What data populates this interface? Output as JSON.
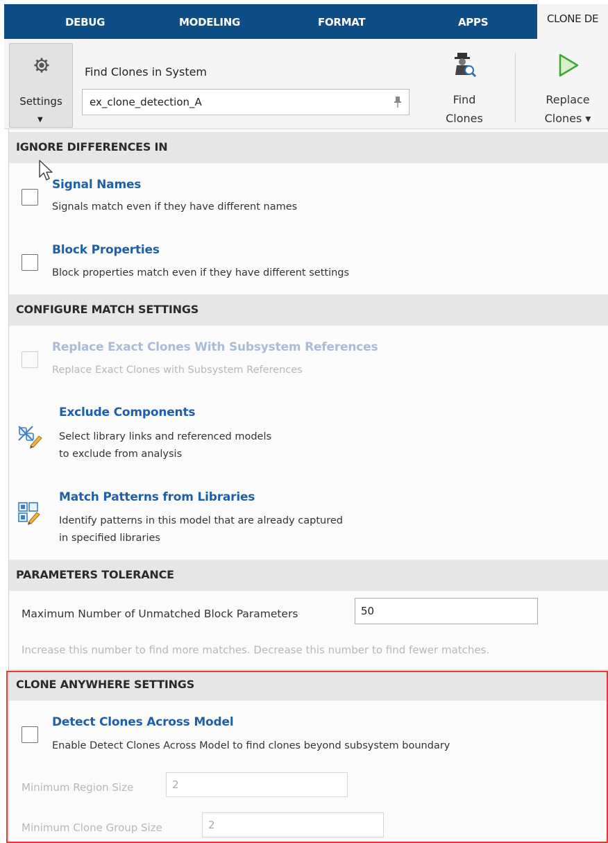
{
  "ribbon": {
    "tabs": [
      "DEBUG",
      "MODELING",
      "FORMAT",
      "APPS"
    ],
    "active_tab": "CLONE DE"
  },
  "toolstrip": {
    "settings_label": "Settings",
    "find_in_system_label": "Find Clones in System",
    "system_value": "ex_clone_detection_A",
    "find_clones_label": [
      "Find",
      "Clones"
    ],
    "replace_clones_label": [
      "Replace",
      "Clones ▾"
    ]
  },
  "ignore": {
    "header": "IGNORE DIFFERENCES IN",
    "signal_names": {
      "title": "Signal Names",
      "desc": "Signals match even if they have different names",
      "checked": false
    },
    "block_properties": {
      "title": "Block Properties",
      "desc": "Block properties match even if they have different settings",
      "checked": false
    }
  },
  "match": {
    "header": "CONFIGURE MATCH SETTINGS",
    "replace_exact": {
      "title": "Replace Exact Clones With Subsystem References",
      "desc": "Replace Exact Clones with Subsystem References",
      "enabled": false
    },
    "exclude": {
      "title": "Exclude Components",
      "desc_line1": "Select library links and referenced models",
      "desc_line2": "to exclude from analysis",
      "icon": "exclude-components-icon"
    },
    "patterns": {
      "title": "Match Patterns from Libraries",
      "desc_line1": "Identify patterns in this model that are already captured",
      "desc_line2": "in specified libraries",
      "icon": "library-patterns-icon"
    }
  },
  "tolerance": {
    "header": "PARAMETERS TOLERANCE",
    "max_label": "Maximum Number of Unmatched Block Parameters",
    "max_value": "50",
    "hint": "Increase this number to find more matches.  Decrease this number to find fewer matches."
  },
  "anywhere": {
    "header": "CLONE ANYWHERE SETTINGS",
    "detect": {
      "title": "Detect Clones Across Model",
      "desc": "Enable Detect Clones Across Model to find clones beyond subsystem boundary",
      "checked": false
    },
    "min_region_label": "Minimum Region Size",
    "min_region_value": "2",
    "min_group_label": "Minimum Clone Group Size",
    "min_group_value": "2"
  },
  "colors": {
    "ribbon": "#0f4d86",
    "link": "#1f5fa8",
    "highlight": "#e53935"
  }
}
